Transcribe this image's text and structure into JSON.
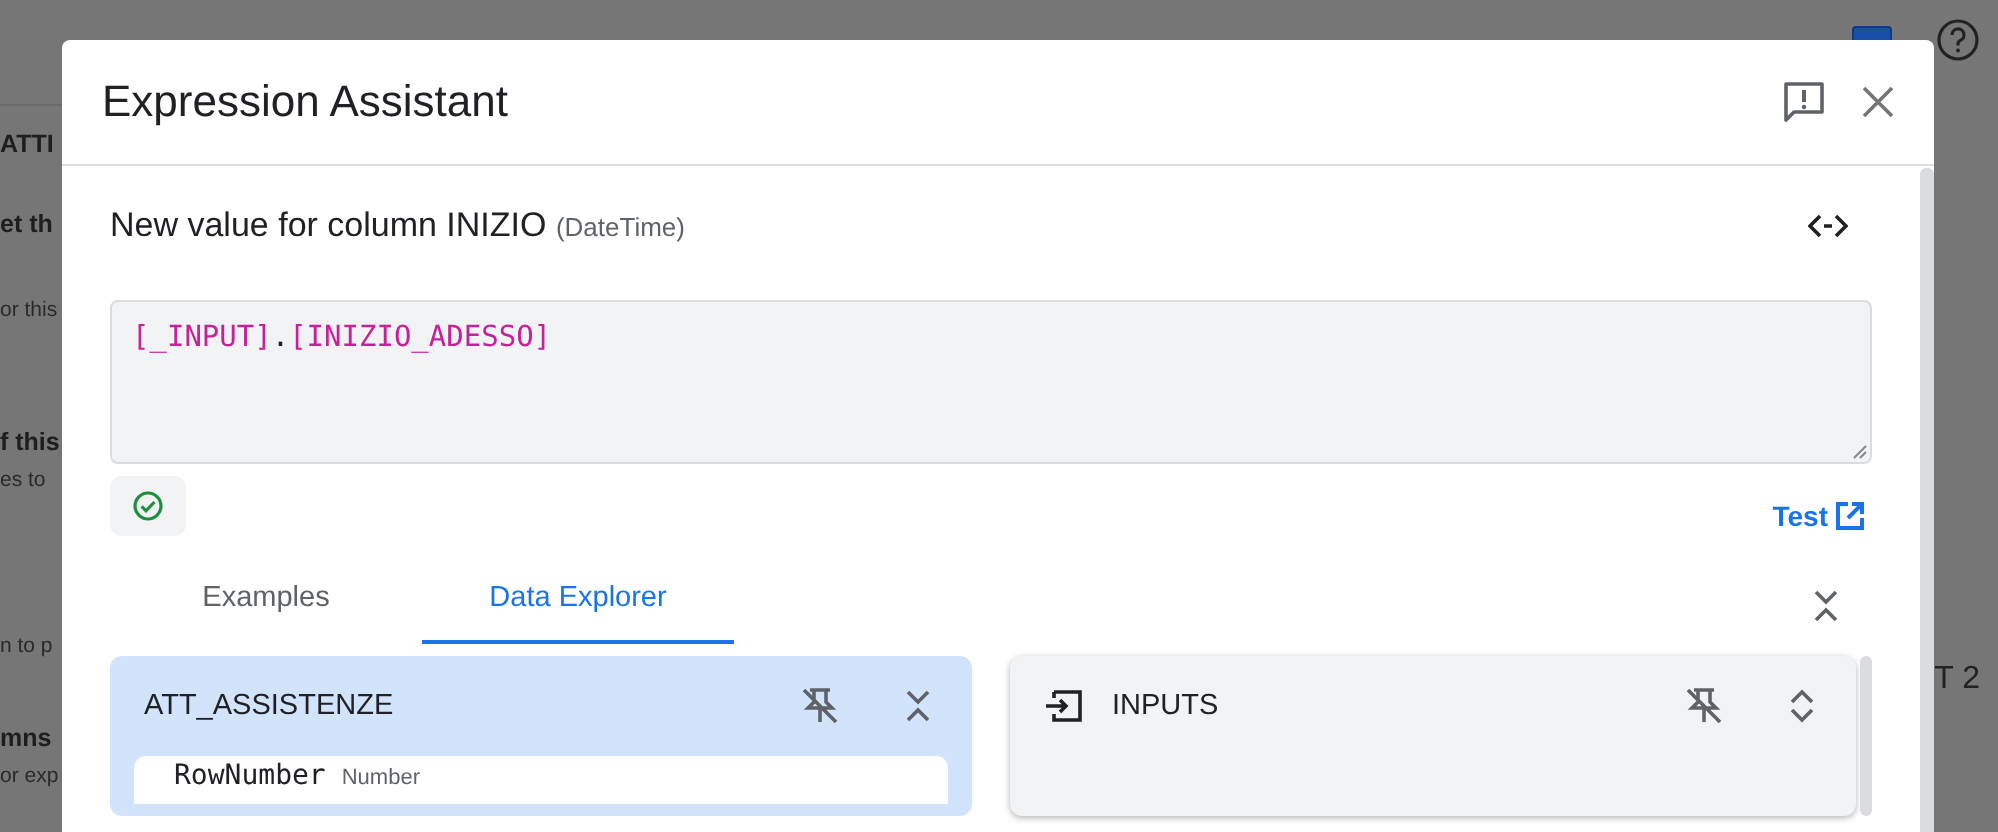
{
  "background_page": {
    "left_fragments": [
      {
        "text": "ATTI",
        "kind": "heading"
      },
      {
        "text": "et th",
        "kind": "heading"
      },
      {
        "text": "or this",
        "kind": "text"
      },
      {
        "text": "f this",
        "kind": "heading"
      },
      {
        "text": "es to",
        "kind": "text"
      },
      {
        "text": "n to p",
        "kind": "text"
      },
      {
        "text": "mns",
        "kind": "heading"
      },
      {
        "text": "or exp",
        "kind": "text"
      }
    ],
    "right_fragment": "T 2"
  },
  "dialog": {
    "title": "Expression Assistant",
    "subtitle": "New value for column INIZIO",
    "subtitle_type": "(DateTime)",
    "expression": [
      {
        "text": "[_INPUT]",
        "kind": "column"
      },
      {
        "text": ".",
        "kind": "operator"
      },
      {
        "text": "[INIZIO_ADESSO]",
        "kind": "column"
      }
    ],
    "valid": true,
    "test_link": "Test",
    "tabs": [
      {
        "label": "Examples",
        "selected": false
      },
      {
        "label": "Data Explorer",
        "selected": true
      }
    ],
    "panels": [
      {
        "kind": "table",
        "title": "ATT_ASSISTENZE",
        "expanded": true,
        "fields": [
          {
            "name": "RowNumber",
            "type": "Number"
          }
        ]
      },
      {
        "kind": "inputs",
        "title": "INPUTS",
        "expanded": false
      }
    ]
  }
}
